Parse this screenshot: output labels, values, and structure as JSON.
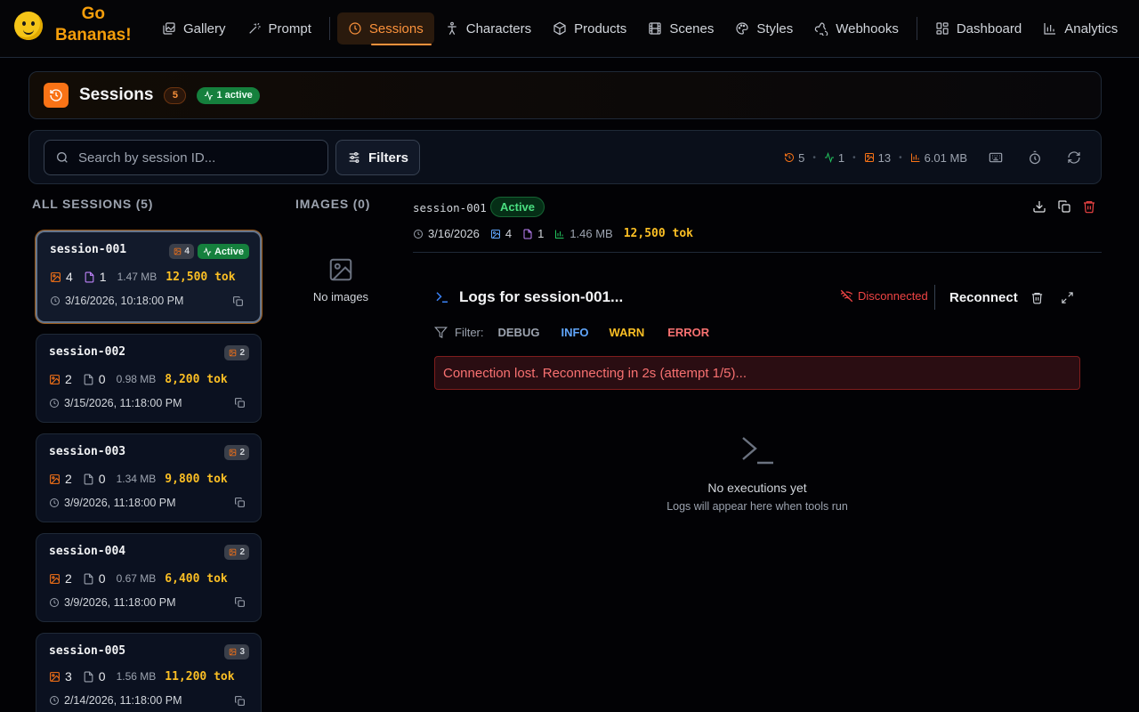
{
  "app": {
    "logo_line1": "Go",
    "logo_line2": "Bananas!"
  },
  "nav": {
    "items": [
      {
        "label": "Gallery",
        "icon": "gallery-icon"
      },
      {
        "label": "Prompt",
        "icon": "wand-icon"
      },
      {
        "label": "Sessions",
        "icon": "history-icon",
        "active": true
      },
      {
        "label": "Characters",
        "icon": "person-icon"
      },
      {
        "label": "Products",
        "icon": "box-icon"
      },
      {
        "label": "Scenes",
        "icon": "film-icon"
      },
      {
        "label": "Styles",
        "icon": "palette-icon"
      },
      {
        "label": "Webhooks",
        "icon": "webhook-icon"
      },
      {
        "label": "Dashboard",
        "icon": "grid-icon"
      },
      {
        "label": "Analytics",
        "icon": "bar-chart-icon"
      }
    ]
  },
  "header": {
    "title": "Sessions",
    "count": "5",
    "active_label": "1 active"
  },
  "toolbar": {
    "search_placeholder": "Search by session ID...",
    "filters_label": "Filters",
    "stats": {
      "sessions": "5",
      "active": "1",
      "images": "13",
      "storage": "6.01 MB"
    }
  },
  "list": {
    "heading": "ALL SESSIONS (5)",
    "sessions": [
      {
        "id": "session-001",
        "image_badge": "4",
        "active_label": "Active",
        "images": "4",
        "files": "1",
        "size": "1.47 MB",
        "tokens": "12,500 tok",
        "date": "3/16/2026, 10:18:00 PM"
      },
      {
        "id": "session-002",
        "image_badge": "2",
        "images": "2",
        "files": "0",
        "size": "0.98 MB",
        "tokens": "8,200 tok",
        "date": "3/15/2026, 11:18:00 PM"
      },
      {
        "id": "session-003",
        "image_badge": "2",
        "images": "2",
        "files": "0",
        "size": "1.34 MB",
        "tokens": "9,800 tok",
        "date": "3/9/2026, 11:18:00 PM"
      },
      {
        "id": "session-004",
        "image_badge": "2",
        "images": "2",
        "files": "0",
        "size": "0.67 MB",
        "tokens": "6,400 tok",
        "date": "3/9/2026, 11:18:00 PM"
      },
      {
        "id": "session-005",
        "image_badge": "3",
        "images": "3",
        "files": "0",
        "size": "1.56 MB",
        "tokens": "11,200 tok",
        "date": "2/14/2026, 11:18:00 PM"
      }
    ]
  },
  "images": {
    "heading": "IMAGES (0)",
    "empty": "No images"
  },
  "detail": {
    "id": "session-001",
    "status": "Active",
    "date": "3/16/2026",
    "images": "4",
    "files": "1",
    "size": "1.46 MB",
    "tokens": "12,500 tok"
  },
  "logs": {
    "title": "Logs for session-001...",
    "status": "Disconnected",
    "reconnect": "Reconnect",
    "filter_label": "Filter:",
    "levels": [
      "DEBUG",
      "INFO",
      "WARN",
      "ERROR"
    ],
    "error_message": "Connection lost. Reconnecting in 2s (attempt 1/5)...",
    "empty_title": "No executions yet",
    "empty_sub": "Logs will appear here when tools run"
  },
  "colors": {
    "accent": "#f97316",
    "active_green": "#15803d",
    "tokens": "#fbbf24",
    "error": "#ef4444",
    "info": "#60a5fa"
  }
}
